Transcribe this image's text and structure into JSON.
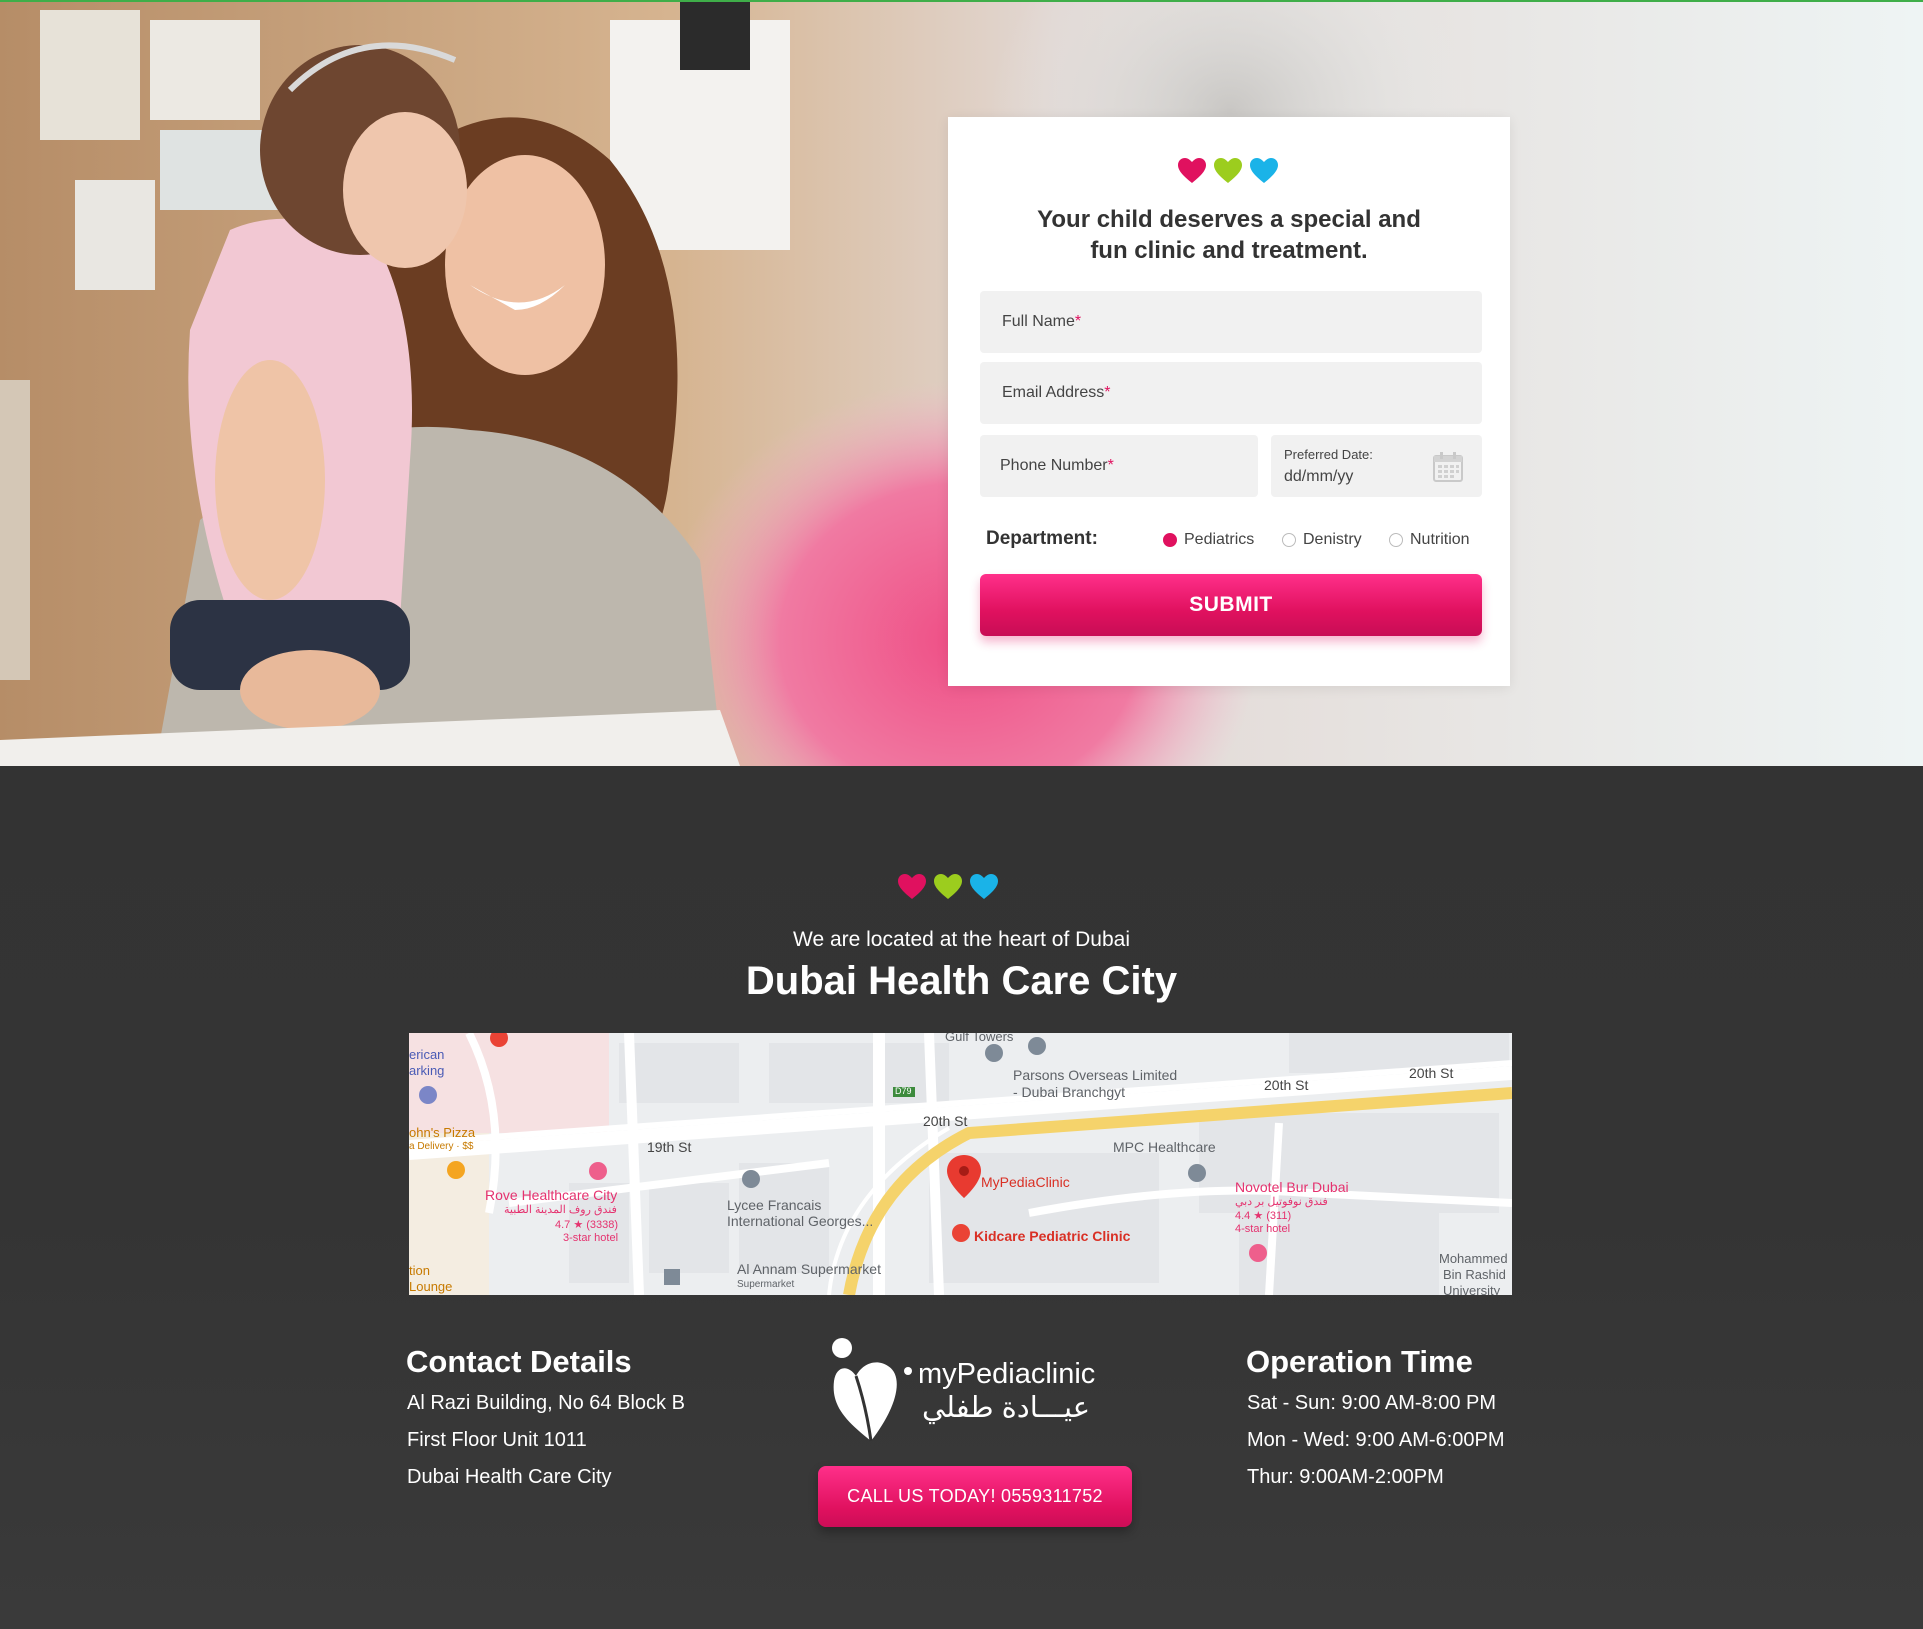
{
  "colors": {
    "pink": "#e0115f",
    "green": "#9ccd1e",
    "blue": "#1ab3e8",
    "dark_bg": "#333333"
  },
  "hero": {
    "form": {
      "title_line1": "Your child deserves a special and",
      "title_line2": "fun clinic and treatment.",
      "full_name_label": "Full Name",
      "email_label": "Email Address",
      "phone_label": "Phone Number",
      "required_mark": "*",
      "date_label": "Preferred Date:",
      "date_placeholder": "dd/mm/yy",
      "department_label": "Department:",
      "departments": [
        "Pediatrics",
        "Denistry",
        "Nutrition"
      ],
      "selected_department": "Pediatrics",
      "submit_label": "SUBMIT"
    }
  },
  "location": {
    "subtitle": "We are located at the heart of Dubai",
    "title": "Dubai Health Care City",
    "map_labels": {
      "gulf_towers": "Gulf Towers",
      "parsons_1": "Parsons Overseas Limited",
      "parsons_2": "- Dubai Branchgyt",
      "st20_a": "20th St",
      "st20_b": "20th St",
      "st20_c": "20th St",
      "st19": "19th St",
      "d79": "D79",
      "american_1": "erican",
      "american_2": "arking",
      "johns_pizza": "ohn's Pizza",
      "johns_pizza_sub": "a Delivery · $$",
      "rove": "Rove Healthcare City",
      "rove_ar": "فندق روف المدينة الطبية",
      "rove_rating": "4.7 ★ (3338)",
      "rove_type": "3-star hotel",
      "lycee_1": "Lycee Francais",
      "lycee_2": "International Georges...",
      "annam": "Al Annam Supermarket",
      "annam_sub": "Supermarket",
      "station_1": "tion",
      "station_2": "Lounge",
      "mypediaclinic": "MyPediaClinic",
      "mpc_healthcare": "MPC Healthcare",
      "kidcare": "Kidcare Pediatric Clinic",
      "novotel": "Novotel Bur Dubai",
      "novotel_ar": "فندق نوفوتيل بر دبي",
      "novotel_rating": "4.4 ★ (311)",
      "novotel_type": "4-star hotel",
      "mbr_1": "Mohammed",
      "mbr_2": "Bin Rashid",
      "mbr_3": "University"
    }
  },
  "footer": {
    "contact": {
      "heading": "Contact Details",
      "lines": [
        "Al Razi Building, No 64 Block B",
        "First Floor Unit 1011",
        "Dubai Health Care City"
      ]
    },
    "logo": {
      "name_en": "myPediaclinic",
      "name_ar": "عيـــادة طفلي"
    },
    "call_label": "CALL US TODAY! 0559311752",
    "hours": {
      "heading": "Operation Time",
      "lines": [
        "Sat - Sun: 9:00 AM-8:00 PM",
        "Mon - Wed: 9:00 AM-6:00PM",
        "Thur: 9:00AM-2:00PM"
      ]
    }
  }
}
